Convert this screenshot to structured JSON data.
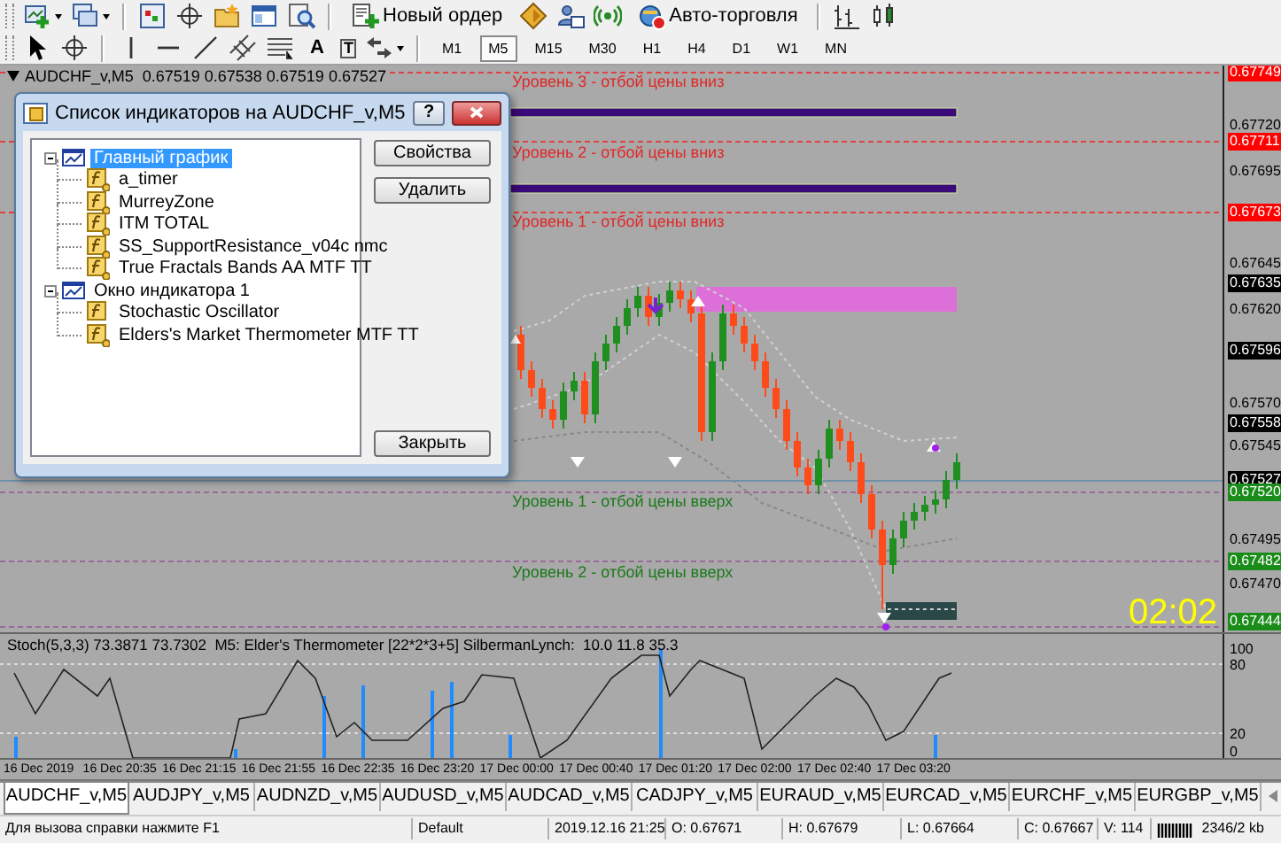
{
  "toolbar": {
    "buttons": [
      {
        "label": "Новый ордер"
      },
      {
        "label": "Авто-торговля"
      }
    ],
    "text_tools": [
      "A",
      "T"
    ]
  },
  "timeframes": [
    {
      "label": "M1",
      "selected": false
    },
    {
      "label": "M5",
      "selected": true
    },
    {
      "label": "M15",
      "selected": false
    },
    {
      "label": "M30",
      "selected": false
    },
    {
      "label": "H1",
      "selected": false
    },
    {
      "label": "H4",
      "selected": false
    },
    {
      "label": "D1",
      "selected": false
    },
    {
      "label": "W1",
      "selected": false
    },
    {
      "label": "MN",
      "selected": false
    }
  ],
  "chart": {
    "header": "AUDCHF_v,M5  0.67519 0.67538 0.67519 0.67527",
    "levels": [
      {
        "text": "Уровень 3 - отбой цены вниз",
        "kind": "resistance"
      },
      {
        "text": "Уровень 2 - отбой цены вниз",
        "kind": "resistance"
      },
      {
        "text": "Уровень 1 - отбой цены вниз",
        "kind": "resistance"
      },
      {
        "text": "Уровень 1 - отбой цены вверх",
        "kind": "support"
      },
      {
        "text": "Уровень 2 - отбой цены вверх",
        "kind": "support"
      }
    ],
    "timer": "02:02",
    "price_axis": [
      {
        "text": "0.67749",
        "kind": "marker",
        "color": "#ff0000"
      },
      {
        "text": "0.67720",
        "kind": "tick"
      },
      {
        "text": "0.67711",
        "kind": "marker",
        "color": "#ff0000"
      },
      {
        "text": "0.67695",
        "kind": "tick"
      },
      {
        "text": "0.67673",
        "kind": "marker",
        "color": "#ff0000"
      },
      {
        "text": "0.67645",
        "kind": "tick"
      },
      {
        "text": "0.67635",
        "kind": "marker",
        "color": "#000000"
      },
      {
        "text": "0.67620",
        "kind": "tick"
      },
      {
        "text": "0.67596",
        "kind": "marker",
        "color": "#000000"
      },
      {
        "text": "0.67570",
        "kind": "tick"
      },
      {
        "text": "0.67558",
        "kind": "marker",
        "color": "#000000"
      },
      {
        "text": "0.67545",
        "kind": "tick"
      },
      {
        "text": "0.67527",
        "kind": "marker",
        "color": "#000000"
      },
      {
        "text": "0.67520",
        "kind": "marker",
        "color": "#1a8c1a"
      },
      {
        "text": "0.67495",
        "kind": "tick"
      },
      {
        "text": "0.67482",
        "kind": "marker",
        "color": "#1a8c1a"
      },
      {
        "text": "0.67470",
        "kind": "tick"
      },
      {
        "text": "0.67444",
        "kind": "marker",
        "color": "#1a8c1a"
      }
    ]
  },
  "dialog": {
    "title": "Список индикаторов на AUDCHF_v,M5",
    "help": "?",
    "tree": [
      {
        "label": "Главный график",
        "selected": true,
        "expanded": true,
        "children": [
          {
            "label": "a_timer",
            "kind": "custom"
          },
          {
            "label": "MurreyZone",
            "kind": "custom"
          },
          {
            "label": "ITM TOTAL",
            "kind": "custom"
          },
          {
            "label": "SS_SupportResistance_v04c nmc",
            "kind": "custom"
          },
          {
            "label": "True Fractals Bands AA MTF TT",
            "kind": "custom"
          }
        ]
      },
      {
        "label": "Окно индикатора 1",
        "selected": false,
        "expanded": true,
        "children": [
          {
            "label": "Stochastic Oscillator",
            "kind": "builtin"
          },
          {
            "label": "Elders's Market Thermometer MTF TT",
            "kind": "custom"
          }
        ]
      }
    ],
    "buttons": [
      {
        "label": "Свойства"
      },
      {
        "label": "Удалить"
      },
      {
        "label": "Закрыть"
      }
    ]
  },
  "subwindow": {
    "header": "Stoch(5,3,3) 73.3871 73.7302  M5: Elder's Thermometer [22*2*3+5] SilbermanLynch:  10.0 11.8 35.3",
    "axis": [
      "100",
      "80",
      "20",
      "0"
    ]
  },
  "time_axis": [
    "16 Dec 2019",
    "16 Dec 20:35",
    "16 Dec 21:15",
    "16 Dec 21:55",
    "16 Dec 22:35",
    "16 Dec 23:20",
    "17 Dec 00:00",
    "17 Dec 00:40",
    "17 Dec 01:20",
    "17 Dec 02:00",
    "17 Dec 02:40",
    "17 Dec 03:20"
  ],
  "tabs": [
    {
      "label": "AUDCHF_v,M5",
      "selected": true
    },
    {
      "label": "AUDJPY_v,M5",
      "selected": false
    },
    {
      "label": "AUDNZD_v,M5",
      "selected": false
    },
    {
      "label": "AUDUSD_v,M5",
      "selected": false
    },
    {
      "label": "AUDCAD_v,M5",
      "selected": false
    },
    {
      "label": "CADJPY_v,M5",
      "selected": false
    },
    {
      "label": "EURAUD_v,M5",
      "selected": false
    },
    {
      "label": "EURCAD_v,M5",
      "selected": false
    },
    {
      "label": "EURCHF_v,M5",
      "selected": false
    },
    {
      "label": "EURGBP_v,M5",
      "selected": false
    }
  ],
  "status_bar": [
    "Для вызова справки нажмите F1",
    "Default",
    "2019.12.16 21:25",
    "O: 0.67671",
    "H: 0.67679",
    "L: 0.67664",
    "C: 0.67667",
    "V: 114",
    "2346/2 kb"
  ]
}
